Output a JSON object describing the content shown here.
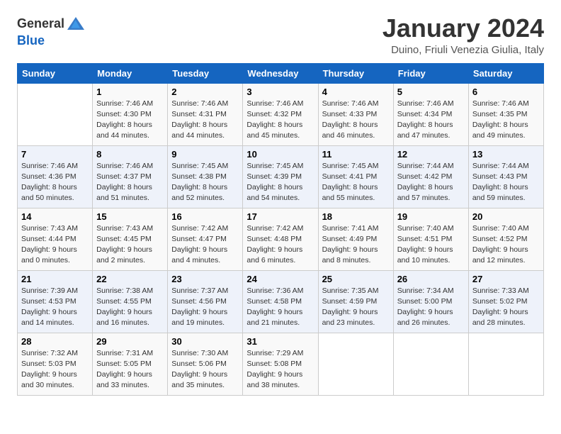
{
  "logo": {
    "text_general": "General",
    "text_blue": "Blue"
  },
  "title": "January 2024",
  "location": "Duino, Friuli Venezia Giulia, Italy",
  "days_of_week": [
    "Sunday",
    "Monday",
    "Tuesday",
    "Wednesday",
    "Thursday",
    "Friday",
    "Saturday"
  ],
  "weeks": [
    [
      {
        "day": "",
        "info": ""
      },
      {
        "day": "1",
        "info": "Sunrise: 7:46 AM\nSunset: 4:30 PM\nDaylight: 8 hours\nand 44 minutes."
      },
      {
        "day": "2",
        "info": "Sunrise: 7:46 AM\nSunset: 4:31 PM\nDaylight: 8 hours\nand 44 minutes."
      },
      {
        "day": "3",
        "info": "Sunrise: 7:46 AM\nSunset: 4:32 PM\nDaylight: 8 hours\nand 45 minutes."
      },
      {
        "day": "4",
        "info": "Sunrise: 7:46 AM\nSunset: 4:33 PM\nDaylight: 8 hours\nand 46 minutes."
      },
      {
        "day": "5",
        "info": "Sunrise: 7:46 AM\nSunset: 4:34 PM\nDaylight: 8 hours\nand 47 minutes."
      },
      {
        "day": "6",
        "info": "Sunrise: 7:46 AM\nSunset: 4:35 PM\nDaylight: 8 hours\nand 49 minutes."
      }
    ],
    [
      {
        "day": "7",
        "info": "Sunrise: 7:46 AM\nSunset: 4:36 PM\nDaylight: 8 hours\nand 50 minutes."
      },
      {
        "day": "8",
        "info": "Sunrise: 7:46 AM\nSunset: 4:37 PM\nDaylight: 8 hours\nand 51 minutes."
      },
      {
        "day": "9",
        "info": "Sunrise: 7:45 AM\nSunset: 4:38 PM\nDaylight: 8 hours\nand 52 minutes."
      },
      {
        "day": "10",
        "info": "Sunrise: 7:45 AM\nSunset: 4:39 PM\nDaylight: 8 hours\nand 54 minutes."
      },
      {
        "day": "11",
        "info": "Sunrise: 7:45 AM\nSunset: 4:41 PM\nDaylight: 8 hours\nand 55 minutes."
      },
      {
        "day": "12",
        "info": "Sunrise: 7:44 AM\nSunset: 4:42 PM\nDaylight: 8 hours\nand 57 minutes."
      },
      {
        "day": "13",
        "info": "Sunrise: 7:44 AM\nSunset: 4:43 PM\nDaylight: 8 hours\nand 59 minutes."
      }
    ],
    [
      {
        "day": "14",
        "info": "Sunrise: 7:43 AM\nSunset: 4:44 PM\nDaylight: 9 hours\nand 0 minutes."
      },
      {
        "day": "15",
        "info": "Sunrise: 7:43 AM\nSunset: 4:45 PM\nDaylight: 9 hours\nand 2 minutes."
      },
      {
        "day": "16",
        "info": "Sunrise: 7:42 AM\nSunset: 4:47 PM\nDaylight: 9 hours\nand 4 minutes."
      },
      {
        "day": "17",
        "info": "Sunrise: 7:42 AM\nSunset: 4:48 PM\nDaylight: 9 hours\nand 6 minutes."
      },
      {
        "day": "18",
        "info": "Sunrise: 7:41 AM\nSunset: 4:49 PM\nDaylight: 9 hours\nand 8 minutes."
      },
      {
        "day": "19",
        "info": "Sunrise: 7:40 AM\nSunset: 4:51 PM\nDaylight: 9 hours\nand 10 minutes."
      },
      {
        "day": "20",
        "info": "Sunrise: 7:40 AM\nSunset: 4:52 PM\nDaylight: 9 hours\nand 12 minutes."
      }
    ],
    [
      {
        "day": "21",
        "info": "Sunrise: 7:39 AM\nSunset: 4:53 PM\nDaylight: 9 hours\nand 14 minutes."
      },
      {
        "day": "22",
        "info": "Sunrise: 7:38 AM\nSunset: 4:55 PM\nDaylight: 9 hours\nand 16 minutes."
      },
      {
        "day": "23",
        "info": "Sunrise: 7:37 AM\nSunset: 4:56 PM\nDaylight: 9 hours\nand 19 minutes."
      },
      {
        "day": "24",
        "info": "Sunrise: 7:36 AM\nSunset: 4:58 PM\nDaylight: 9 hours\nand 21 minutes."
      },
      {
        "day": "25",
        "info": "Sunrise: 7:35 AM\nSunset: 4:59 PM\nDaylight: 9 hours\nand 23 minutes."
      },
      {
        "day": "26",
        "info": "Sunrise: 7:34 AM\nSunset: 5:00 PM\nDaylight: 9 hours\nand 26 minutes."
      },
      {
        "day": "27",
        "info": "Sunrise: 7:33 AM\nSunset: 5:02 PM\nDaylight: 9 hours\nand 28 minutes."
      }
    ],
    [
      {
        "day": "28",
        "info": "Sunrise: 7:32 AM\nSunset: 5:03 PM\nDaylight: 9 hours\nand 30 minutes."
      },
      {
        "day": "29",
        "info": "Sunrise: 7:31 AM\nSunset: 5:05 PM\nDaylight: 9 hours\nand 33 minutes."
      },
      {
        "day": "30",
        "info": "Sunrise: 7:30 AM\nSunset: 5:06 PM\nDaylight: 9 hours\nand 35 minutes."
      },
      {
        "day": "31",
        "info": "Sunrise: 7:29 AM\nSunset: 5:08 PM\nDaylight: 9 hours\nand 38 minutes."
      },
      {
        "day": "",
        "info": ""
      },
      {
        "day": "",
        "info": ""
      },
      {
        "day": "",
        "info": ""
      }
    ]
  ]
}
